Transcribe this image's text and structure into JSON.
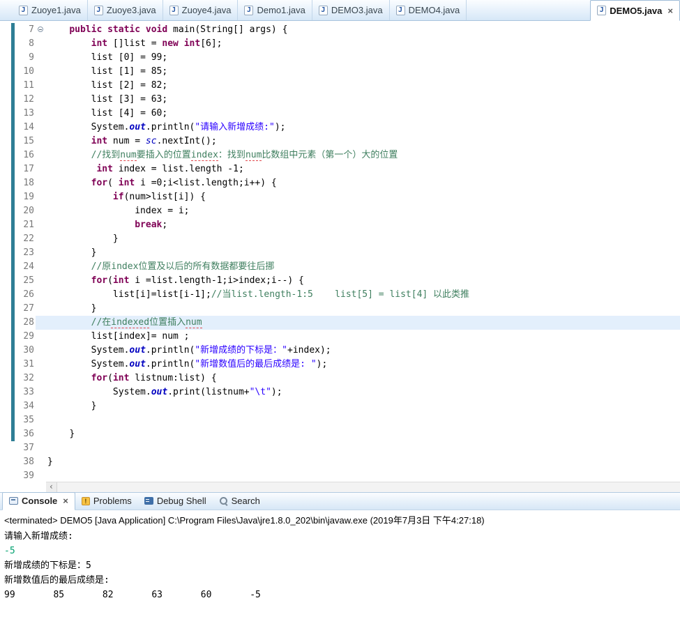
{
  "icons": {
    "java_file": "J",
    "close": "×",
    "scroll_left": "‹"
  },
  "colors": {
    "keyword": "#7f0055",
    "string": "#2a00ff",
    "comment": "#3f7f5f",
    "field": "#0000c0",
    "linenum": "#787878",
    "changebar": "#2e7e95",
    "currentline": "#e3effc",
    "stdin": "#00a06e",
    "squiggle": "#e0474c",
    "tab_text": "#39464f"
  },
  "editor_tabs": {
    "items": [
      {
        "label": "Zuoye1.java",
        "active": false
      },
      {
        "label": "Zuoye3.java",
        "active": false
      },
      {
        "label": "Zuoye4.java",
        "active": false
      },
      {
        "label": "Demo1.java",
        "active": false
      },
      {
        "label": "DEMO3.java",
        "active": false
      },
      {
        "label": "DEMO4.java",
        "active": false
      },
      {
        "label": "DEMO5.java",
        "active": true
      }
    ]
  },
  "editor": {
    "lines": [
      {
        "n": "7",
        "ind": 4,
        "chg": true,
        "fold": true,
        "tokens": [
          [
            "kw",
            "public"
          ],
          [
            "pl",
            " "
          ],
          [
            "kw",
            "static"
          ],
          [
            "pl",
            " "
          ],
          [
            "kw",
            "void"
          ],
          [
            "pl",
            " main(String[] args) {"
          ]
        ]
      },
      {
        "n": "8",
        "ind": 8,
        "chg": true,
        "tokens": [
          [
            "kw",
            "int"
          ],
          [
            "pl",
            " []list = "
          ],
          [
            "kw",
            "new"
          ],
          [
            "pl",
            " "
          ],
          [
            "kw",
            "int"
          ],
          [
            "pl",
            "[6];"
          ]
        ]
      },
      {
        "n": "9",
        "ind": 8,
        "chg": true,
        "tokens": [
          [
            "pl",
            "list [0] = 99;"
          ]
        ]
      },
      {
        "n": "10",
        "ind": 8,
        "chg": true,
        "tokens": [
          [
            "pl",
            "list [1] = 85;"
          ]
        ]
      },
      {
        "n": "11",
        "ind": 8,
        "chg": true,
        "tokens": [
          [
            "pl",
            "list [2] = 82;"
          ]
        ]
      },
      {
        "n": "12",
        "ind": 8,
        "chg": true,
        "tokens": [
          [
            "pl",
            "list [3] = 63;"
          ]
        ]
      },
      {
        "n": "13",
        "ind": 8,
        "chg": true,
        "tokens": [
          [
            "pl",
            "list [4] = 60;"
          ]
        ]
      },
      {
        "n": "14",
        "ind": 8,
        "chg": true,
        "tokens": [
          [
            "pl",
            "System."
          ],
          [
            "out",
            "out"
          ],
          [
            "pl",
            ".println("
          ],
          [
            "str",
            "\"请输入新增成绩:\""
          ],
          [
            "pl",
            ");"
          ]
        ]
      },
      {
        "n": "15",
        "ind": 8,
        "chg": true,
        "tokens": [
          [
            "kw",
            "int"
          ],
          [
            "pl",
            " num = "
          ],
          [
            "sc",
            "sc"
          ],
          [
            "pl",
            ".nextInt();"
          ]
        ]
      },
      {
        "n": "16",
        "ind": 8,
        "chg": true,
        "tokens": [
          [
            "com",
            "//找到"
          ],
          [
            "sq",
            "num"
          ],
          [
            "com",
            "要插入的位置"
          ],
          [
            "sq",
            "index"
          ],
          [
            "com",
            "：找到"
          ],
          [
            "sq",
            "num"
          ],
          [
            "com",
            "比数组中元素（第一个）大的位置"
          ]
        ]
      },
      {
        "n": "17",
        "ind": 9,
        "chg": true,
        "tokens": [
          [
            "kw",
            "int"
          ],
          [
            "pl",
            " index = list.length -1;"
          ]
        ]
      },
      {
        "n": "18",
        "ind": 8,
        "chg": true,
        "tokens": [
          [
            "kw",
            "for"
          ],
          [
            "pl",
            "( "
          ],
          [
            "kw",
            "int"
          ],
          [
            "pl",
            " i =0;i<list.length;i++) {"
          ]
        ]
      },
      {
        "n": "19",
        "ind": 12,
        "chg": true,
        "tokens": [
          [
            "kw",
            "if"
          ],
          [
            "pl",
            "(num>list[i]) {"
          ]
        ]
      },
      {
        "n": "20",
        "ind": 16,
        "chg": true,
        "tokens": [
          [
            "pl",
            "index = i;"
          ]
        ]
      },
      {
        "n": "21",
        "ind": 16,
        "chg": true,
        "tokens": [
          [
            "kw",
            "break"
          ],
          [
            "pl",
            ";"
          ]
        ]
      },
      {
        "n": "22",
        "ind": 12,
        "chg": true,
        "tokens": [
          [
            "pl",
            "}"
          ]
        ]
      },
      {
        "n": "23",
        "ind": 8,
        "chg": true,
        "tokens": [
          [
            "pl",
            "}"
          ]
        ]
      },
      {
        "n": "24",
        "ind": 8,
        "chg": true,
        "tokens": [
          [
            "com",
            "//原index位置及以后的所有数据都要往后挪"
          ]
        ]
      },
      {
        "n": "25",
        "ind": 8,
        "chg": true,
        "tokens": [
          [
            "kw",
            "for"
          ],
          [
            "pl",
            "("
          ],
          [
            "kw",
            "int"
          ],
          [
            "pl",
            " i =list.length-1;i>index;i--) {"
          ]
        ]
      },
      {
        "n": "26",
        "ind": 12,
        "chg": true,
        "tokens": [
          [
            "pl",
            "list[i]=list[i-1];"
          ],
          [
            "com",
            "//当list.length-1:5    list[5] = list[4] 以此类推"
          ]
        ]
      },
      {
        "n": "27",
        "ind": 8,
        "chg": true,
        "tokens": [
          [
            "pl",
            "}"
          ]
        ]
      },
      {
        "n": "28",
        "ind": 8,
        "chg": true,
        "hl": true,
        "tokens": [
          [
            "com",
            "//在"
          ],
          [
            "sq",
            "indexed"
          ],
          [
            "com",
            "位置插入"
          ],
          [
            "sq",
            "num"
          ]
        ]
      },
      {
        "n": "29",
        "ind": 8,
        "chg": true,
        "tokens": [
          [
            "pl",
            "list[index]= num ;"
          ]
        ]
      },
      {
        "n": "30",
        "ind": 8,
        "chg": true,
        "tokens": [
          [
            "pl",
            "System."
          ],
          [
            "out",
            "out"
          ],
          [
            "pl",
            ".println("
          ],
          [
            "str",
            "\"新增成绩的下标是：\""
          ],
          [
            "pl",
            "+index);"
          ]
        ]
      },
      {
        "n": "31",
        "ind": 8,
        "chg": true,
        "tokens": [
          [
            "pl",
            "System."
          ],
          [
            "out",
            "out"
          ],
          [
            "pl",
            ".println("
          ],
          [
            "str",
            "\"新增数值后的最后成绩是: \""
          ],
          [
            "pl",
            ");"
          ]
        ]
      },
      {
        "n": "32",
        "ind": 8,
        "chg": true,
        "tokens": [
          [
            "kw",
            "for"
          ],
          [
            "pl",
            "("
          ],
          [
            "kw",
            "int"
          ],
          [
            "pl",
            " listnum:list) {"
          ]
        ]
      },
      {
        "n": "33",
        "ind": 12,
        "chg": true,
        "tokens": [
          [
            "pl",
            "System."
          ],
          [
            "out",
            "out"
          ],
          [
            "pl",
            ".print(listnum+"
          ],
          [
            "str",
            "\"\\t\""
          ],
          [
            "pl",
            ");"
          ]
        ]
      },
      {
        "n": "34",
        "ind": 8,
        "chg": true,
        "tokens": [
          [
            "pl",
            "}"
          ]
        ]
      },
      {
        "n": "35",
        "ind": 0,
        "chg": true,
        "tokens": []
      },
      {
        "n": "36",
        "ind": 4,
        "chg": true,
        "tokens": [
          [
            "pl",
            "}"
          ]
        ]
      },
      {
        "n": "37",
        "ind": 0,
        "chg": false,
        "tokens": []
      },
      {
        "n": "38",
        "ind": 0,
        "chg": false,
        "tokens": [
          [
            "pl",
            "}"
          ]
        ]
      },
      {
        "n": "39",
        "ind": 0,
        "chg": false,
        "tokens": []
      }
    ]
  },
  "console": {
    "tabs": [
      {
        "label": "Console",
        "active": true,
        "icon": "console-icon"
      },
      {
        "label": "Problems",
        "active": false,
        "icon": "problems-icon"
      },
      {
        "label": "Debug Shell",
        "active": false,
        "icon": "debug-shell-icon"
      },
      {
        "label": "Search",
        "active": false,
        "icon": "search-icon"
      }
    ],
    "status": "<terminated> DEMO5 [Java Application] C:\\Program Files\\Java\\jre1.8.0_202\\bin\\javaw.exe (2019年7月3日 下午4:27:18)",
    "output": [
      {
        "type": "out",
        "text": "请输入新增成绩:"
      },
      {
        "type": "in",
        "text": "-5"
      },
      {
        "type": "out",
        "text": "新增成绩的下标是：5"
      },
      {
        "type": "out",
        "text": "新增数值后的最后成绩是: "
      },
      {
        "type": "out",
        "text": "99\t85\t82\t63\t60\t-5"
      }
    ]
  }
}
